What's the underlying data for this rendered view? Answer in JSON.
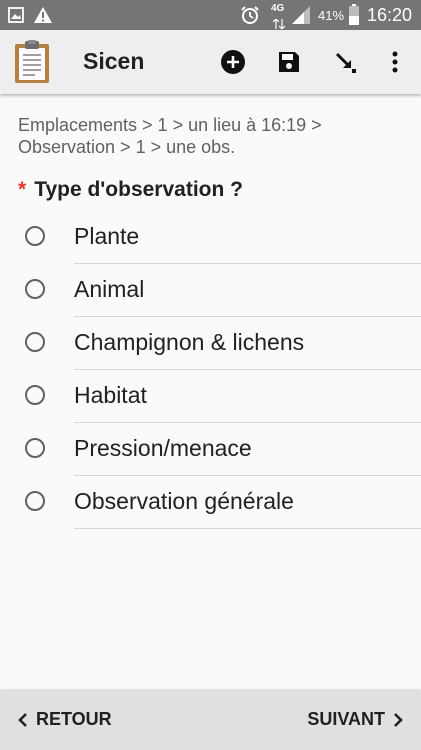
{
  "status_bar": {
    "icons_left": [
      "image-icon",
      "warning-icon"
    ],
    "icons_right": [
      "alarm-icon",
      "network-4g-icon",
      "signal-icon",
      "battery-icon"
    ],
    "network_label": "4G",
    "battery_percent": "41%",
    "time": "16:20"
  },
  "app_bar": {
    "title": "Sicen",
    "actions": [
      "add-circle-icon",
      "save-icon",
      "download-arrow-icon",
      "more-vert-icon"
    ]
  },
  "breadcrumb": "Emplacements > 1 > un lieu à 16:19 > Observation > 1 > une obs.",
  "question": {
    "required_marker": "*",
    "label": "Type d'observation ?"
  },
  "options": [
    {
      "label": "Plante"
    },
    {
      "label": "Animal"
    },
    {
      "label": "Champignon & lichens"
    },
    {
      "label": "Habitat"
    },
    {
      "label": "Pression/menace"
    },
    {
      "label": "Observation générale"
    }
  ],
  "bottom_nav": {
    "back_label": "RETOUR",
    "next_label": "SUIVANT"
  },
  "colors": {
    "status_bar": "#757575",
    "app_bar": "#eeeeee",
    "required": "#e53935",
    "bottom_bar": "#e0e0e0"
  }
}
